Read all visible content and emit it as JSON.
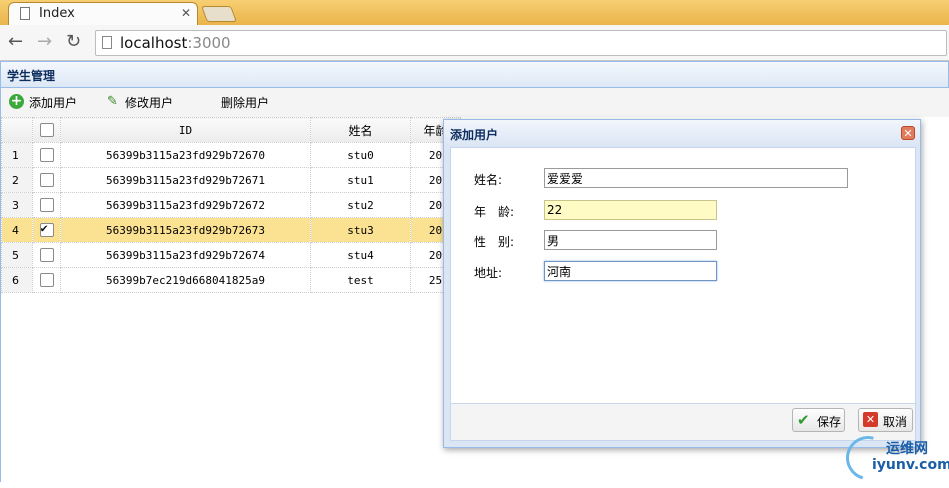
{
  "browser": {
    "tab_title": "Index",
    "url_host": "localhost",
    "url_port": ":3000"
  },
  "panel": {
    "title": "学生管理"
  },
  "toolbar": {
    "add_label": "添加用户",
    "edit_label": "修改用户",
    "delete_label": "删除用户"
  },
  "grid": {
    "columns": [
      "ID",
      "姓名",
      "年龄"
    ],
    "rows": [
      {
        "num": "1",
        "id": "56399b3115a23fd929b72670",
        "name": "stu0",
        "age": "20",
        "checked": false
      },
      {
        "num": "2",
        "id": "56399b3115a23fd929b72671",
        "name": "stu1",
        "age": "20",
        "checked": false
      },
      {
        "num": "3",
        "id": "56399b3115a23fd929b72672",
        "name": "stu2",
        "age": "20",
        "checked": false
      },
      {
        "num": "4",
        "id": "56399b3115a23fd929b72673",
        "name": "stu3",
        "age": "20",
        "checked": true
      },
      {
        "num": "5",
        "id": "56399b3115a23fd929b72674",
        "name": "stu4",
        "age": "20",
        "checked": false
      },
      {
        "num": "6",
        "id": "56399b7ec219d668041825a9",
        "name": "test",
        "age": "25",
        "checked": false
      }
    ]
  },
  "dialog": {
    "title": "添加用户",
    "fields": {
      "name_label": "姓名:",
      "name_value": "爱爱爱",
      "age_label": "年　龄:",
      "age_value": "22",
      "gender_label": "性　别:",
      "gender_value": "男",
      "address_label": "地址:",
      "address_value": "河南"
    },
    "save_label": "保存",
    "cancel_label": "取消"
  },
  "watermark": {
    "line1": "运维网",
    "line2": "iyunv.com"
  }
}
